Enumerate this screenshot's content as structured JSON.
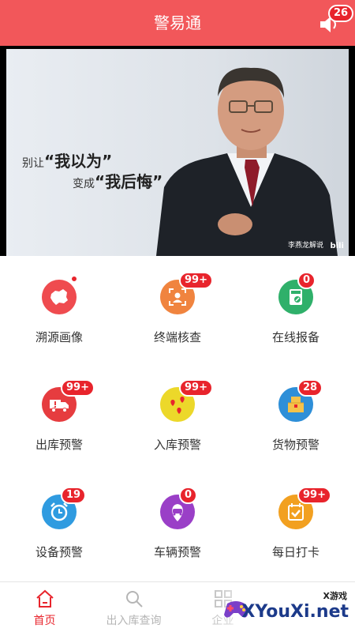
{
  "header": {
    "title": "警易通",
    "notification_count": "26",
    "background": "#f2575a"
  },
  "banner": {
    "line1_prefix": "别让",
    "line1_quote": "“我以为”",
    "line2_prefix": "变成",
    "line2_quote": "“我后悔”",
    "caption": "李燕龙解说",
    "logo": "bili"
  },
  "grid": {
    "items": [
      {
        "label": "溯源画像",
        "icon": "china-map-icon",
        "color": "#ef4b4f",
        "badge": ""
      },
      {
        "label": "终端核查",
        "icon": "id-scan-icon",
        "color": "#f0843f",
        "badge": "99+"
      },
      {
        "label": "在线报备",
        "icon": "report-edit-icon",
        "color": "#2fb06a",
        "badge": "0"
      },
      {
        "label": "出库预警",
        "icon": "truck-alert-icon",
        "color": "#e63c3f",
        "badge": "99+"
      },
      {
        "label": "入库预警",
        "icon": "location-pins-icon",
        "color": "#ecd82a",
        "badge": "99+"
      },
      {
        "label": "货物预警",
        "icon": "goods-box-icon",
        "color": "#2e8fd8",
        "badge": "28"
      },
      {
        "label": "设备预警",
        "icon": "alarm-clock-icon",
        "color": "#2f9be0",
        "badge": "19"
      },
      {
        "label": "车辆预警",
        "icon": "car-pin-icon",
        "color": "#9a3fc7",
        "badge": "0"
      },
      {
        "label": "每日打卡",
        "icon": "calendar-check-icon",
        "color": "#f2a020",
        "badge": "99+"
      }
    ]
  },
  "bottom_nav": {
    "items": [
      {
        "label": "首页",
        "icon": "home-icon",
        "active": true
      },
      {
        "label": "出入库查询",
        "icon": "search-icon",
        "active": false
      },
      {
        "label": "企业",
        "icon": "grid-icon",
        "active": false
      }
    ]
  },
  "watermark": {
    "top": "X游戏",
    "main": "XYouXi.net"
  },
  "colors": {
    "accent": "#e8242c",
    "inactive": "#b5b5b5"
  }
}
